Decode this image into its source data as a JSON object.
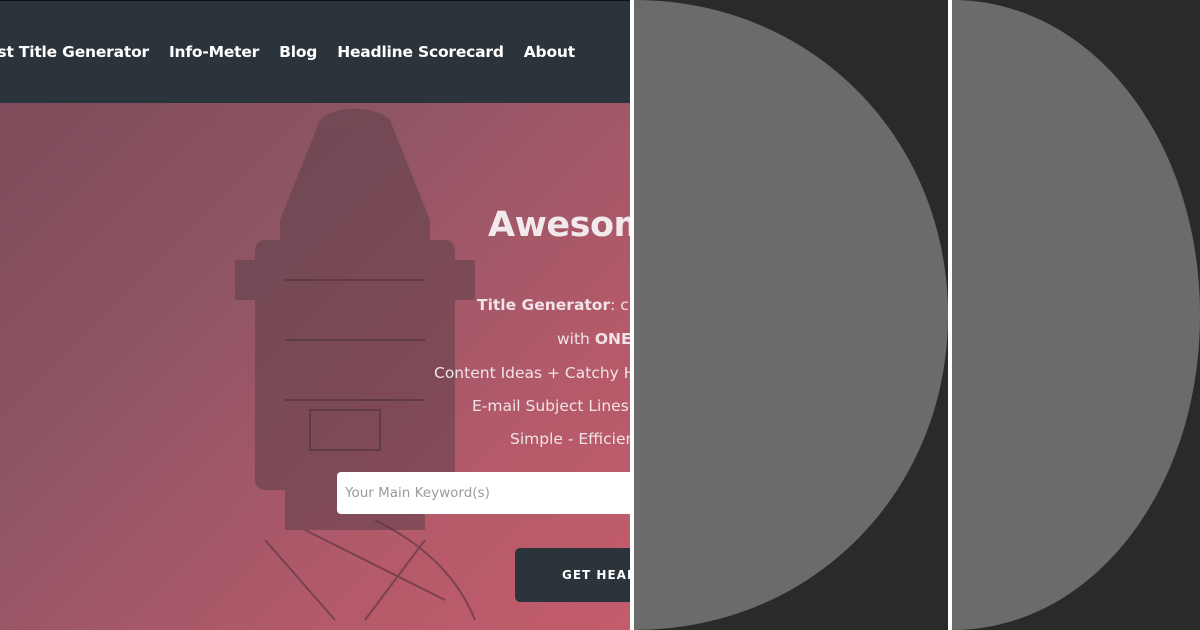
{
  "nav": {
    "items": [
      {
        "label": "e Best Title Generator"
      },
      {
        "label": "Info-Meter"
      },
      {
        "label": "Blog"
      },
      {
        "label": "Headline Scorecard"
      },
      {
        "label": "About"
      }
    ]
  },
  "hero": {
    "title": "Awesom",
    "line1_bold": "Title Generator",
    "line1_rest": ": crea",
    "line2_pre": "with ",
    "line2_bold": "ONE",
    "line3": "Content Ideas + Catchy He",
    "line4": "E-mail Subject Lines",
    "line5": "Simple - Efficien"
  },
  "search": {
    "placeholder": "Your Main Keyword(s)"
  },
  "cta": {
    "label": "GET HEAD"
  },
  "colors": {
    "navbar": "#2b343b",
    "hero_gradient_start": "#7a4a58",
    "hero_gradient_end": "#c45c6c",
    "panel_background": "#2a2a2a",
    "disc_fill": "#6b6b6b",
    "separator": "#ffffff"
  }
}
